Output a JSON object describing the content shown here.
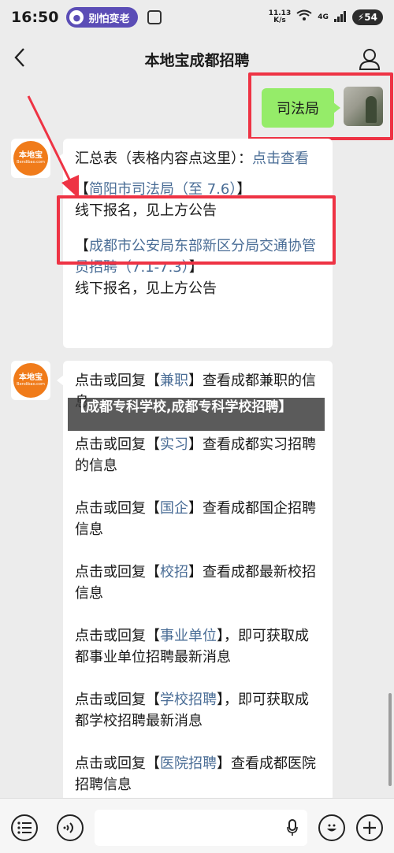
{
  "status_bar": {
    "time": "16:50",
    "pill_label": "别怕变老",
    "net_speed_top": "11.13",
    "net_speed_bottom": "K/s",
    "network": "4G",
    "battery": "54"
  },
  "header": {
    "title": "本地宝成都招聘"
  },
  "sent_message": {
    "text": "司法局"
  },
  "bot_message_1": {
    "line1_prefix": "汇总表（表格内容点这里）：",
    "line1_link": "点击查看",
    "item1_open": "【",
    "item1_link": "简阳市司法局（至 7.6）",
    "item1_close": "】",
    "item1_note": "线下报名，见上方公告",
    "item2_open": "【",
    "item2_link": "成都市公安局东部新区分局交通协管员招聘（7.1-7.3）",
    "item2_close": "】",
    "item2_note": "线下报名，见上方公告"
  },
  "bot_message_2": {
    "items": [
      {
        "pre": "点击或回复【",
        "link": "兼职",
        "post": "】查看成都兼职的信息"
      },
      {
        "pre": "点击或回复【",
        "link": "实习",
        "post": "】查看成都实习招聘的信息"
      },
      {
        "pre": "点击或回复【",
        "link": "国企",
        "post": "】查看成都国企招聘信息"
      },
      {
        "pre": "点击或回复【",
        "link": "校招",
        "post": "】查看成都最新校招信息"
      },
      {
        "pre": "点击或回复【",
        "link": "事业单位",
        "post": "】，即可获取成都事业单位招聘最新消息"
      },
      {
        "pre": "点击或回复【",
        "link": "学校招聘",
        "post": "】，即可获取成都学校招聘最新消息"
      },
      {
        "pre": "点击或回复【",
        "link": "医院招聘",
        "post": "】查看成都医院招聘信息"
      }
    ]
  },
  "avatar_logo": {
    "main": "本地宝",
    "sub": "Bendibao.com"
  },
  "banner": {
    "text": "【成都专科学校,成都专科学校招聘】"
  },
  "colors": {
    "link": "#4a6d96",
    "highlight_red": "#ee3344",
    "sent_bubble": "#95ec69",
    "logo_orange": "#f07b1a"
  }
}
